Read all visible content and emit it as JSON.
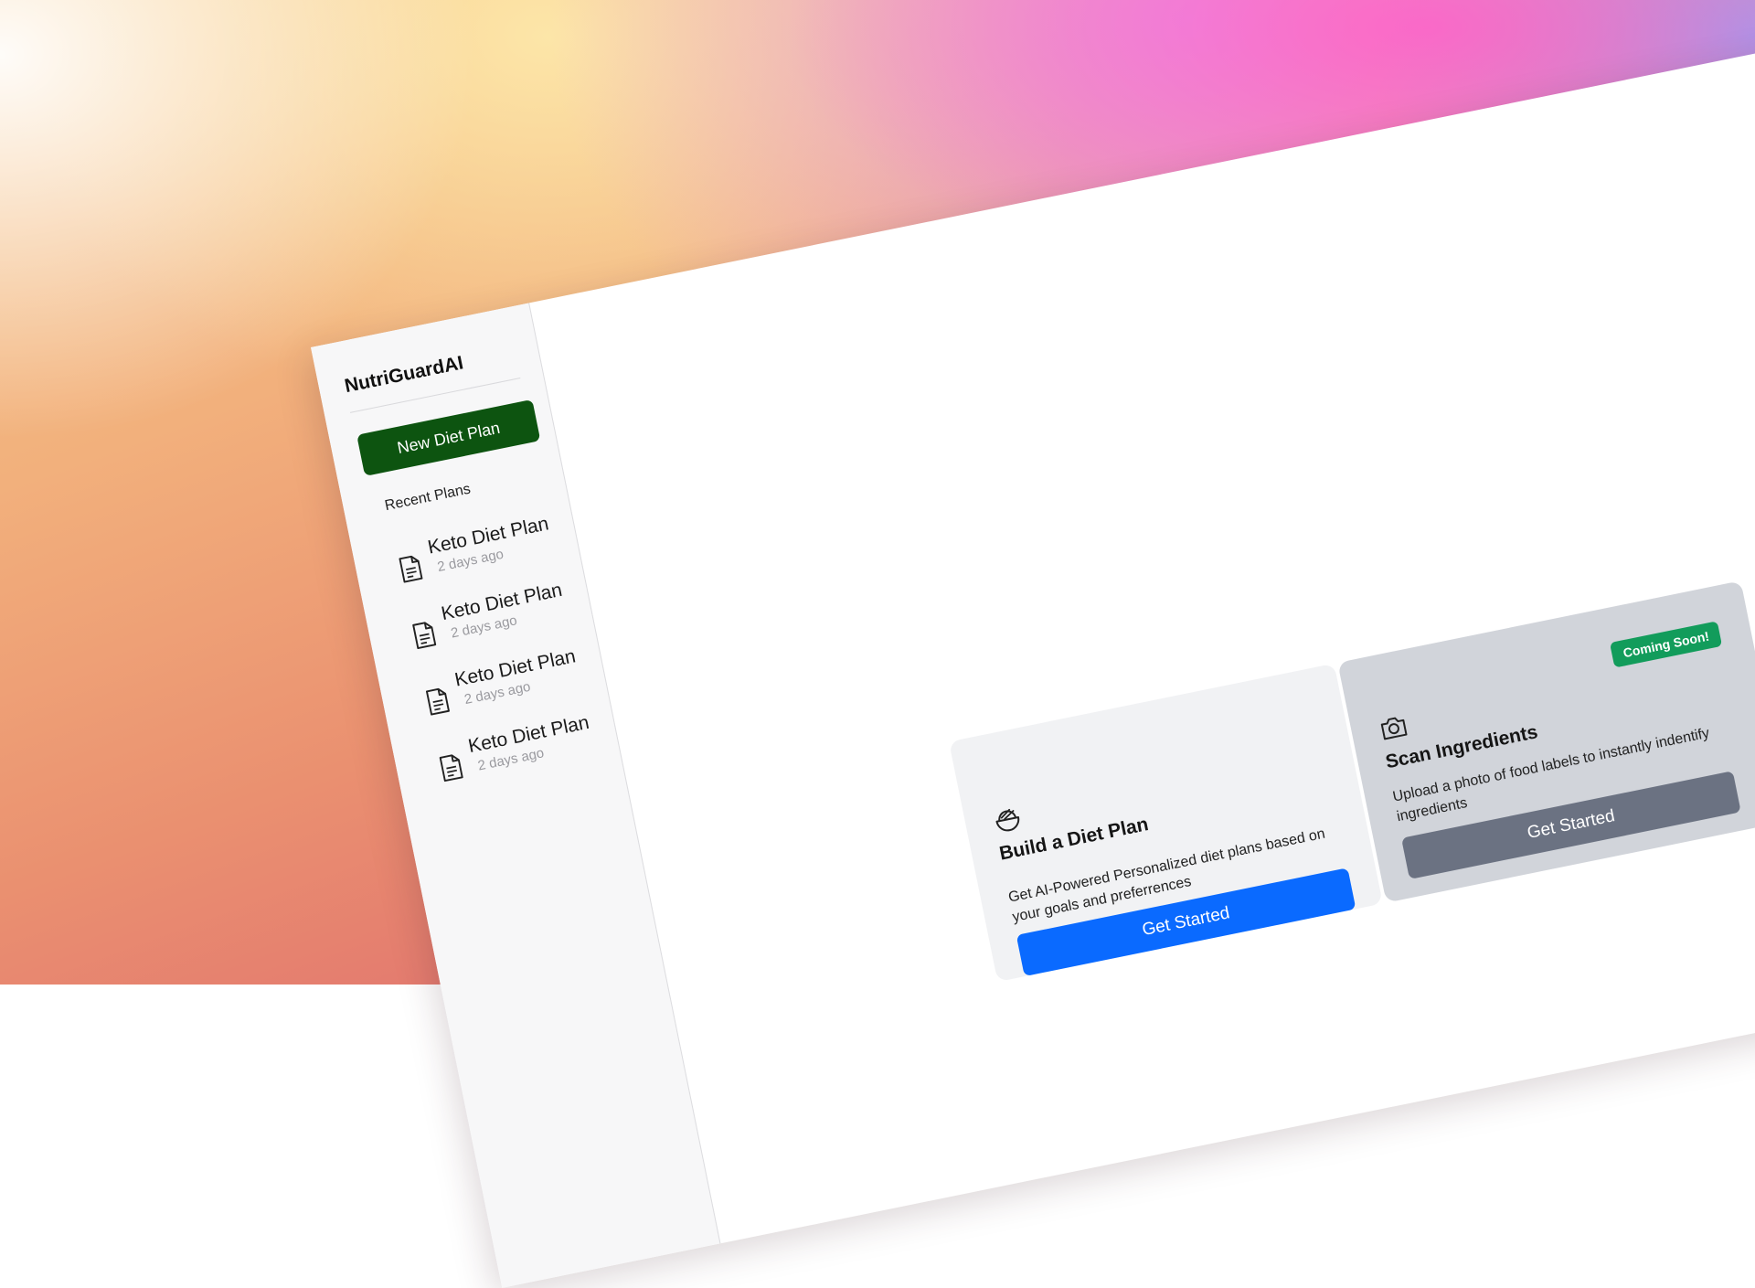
{
  "sidebar": {
    "brand": "NutriGuardAI",
    "new_plan_label": "New Diet Plan",
    "recent_heading": "Recent Plans",
    "plans": [
      {
        "title": "Keto Diet Plan",
        "time": "2 days ago",
        "icon": "document-icon"
      },
      {
        "title": "Keto Diet Plan",
        "time": "2 days ago",
        "icon": "document-icon"
      },
      {
        "title": "Keto Diet Plan",
        "time": "2 days ago",
        "icon": "document-icon"
      },
      {
        "title": "Keto Diet Plan",
        "time": "2 days ago",
        "icon": "document-icon"
      }
    ]
  },
  "cards": {
    "build": {
      "icon": "bowl-icon",
      "title": "Build a Diet Plan",
      "description": "Get AI-Powered Personalized diet plans based on your goals and preferrences",
      "button_label": "Get Started",
      "button_color": "#0a6aff"
    },
    "scan": {
      "icon": "camera-icon",
      "title": "Scan Ingredients",
      "description": "Upload a photo of food labels to instantly indentify ingredients",
      "badge": "Coming Soon!",
      "badge_color": "#129c5b",
      "button_label": "Get Started",
      "button_color": "#6b7282"
    }
  },
  "colors": {
    "new_plan_button": "#0d5410",
    "sidebar_bg": "#f7f7f8"
  }
}
